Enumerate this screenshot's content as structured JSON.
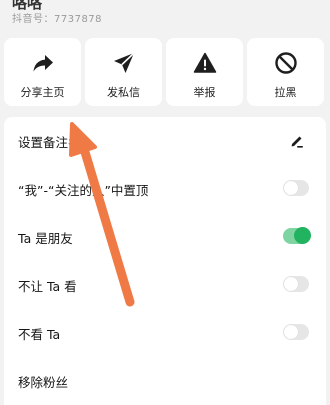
{
  "profile": {
    "name": "咯咯",
    "id_text": "抖音号：7737878"
  },
  "actions": [
    {
      "label": "分享主页",
      "icon": "share-icon"
    },
    {
      "label": "发私信",
      "icon": "send-icon"
    },
    {
      "label": "举报",
      "icon": "warning-icon"
    },
    {
      "label": "拉黑",
      "icon": "block-icon"
    }
  ],
  "settings": {
    "remark": {
      "label": "设置备注名",
      "icon": "edit-icon"
    },
    "pin": {
      "label": "“我”-“关注的人”中置顶",
      "enabled": false
    },
    "friend": {
      "label": "Ta 是朋友",
      "enabled": true
    },
    "hide_from": {
      "label": "不让 Ta 看",
      "enabled": false
    },
    "not_see": {
      "label": "不看 Ta",
      "enabled": false
    },
    "remove_fan": {
      "label": "移除粉丝"
    }
  },
  "colors": {
    "toggle_on": "#21b35f",
    "toggle_on_track": "#7fd4a2",
    "toggle_off_track": "#e6e6e6",
    "annotation_arrow": "#f07a45"
  }
}
